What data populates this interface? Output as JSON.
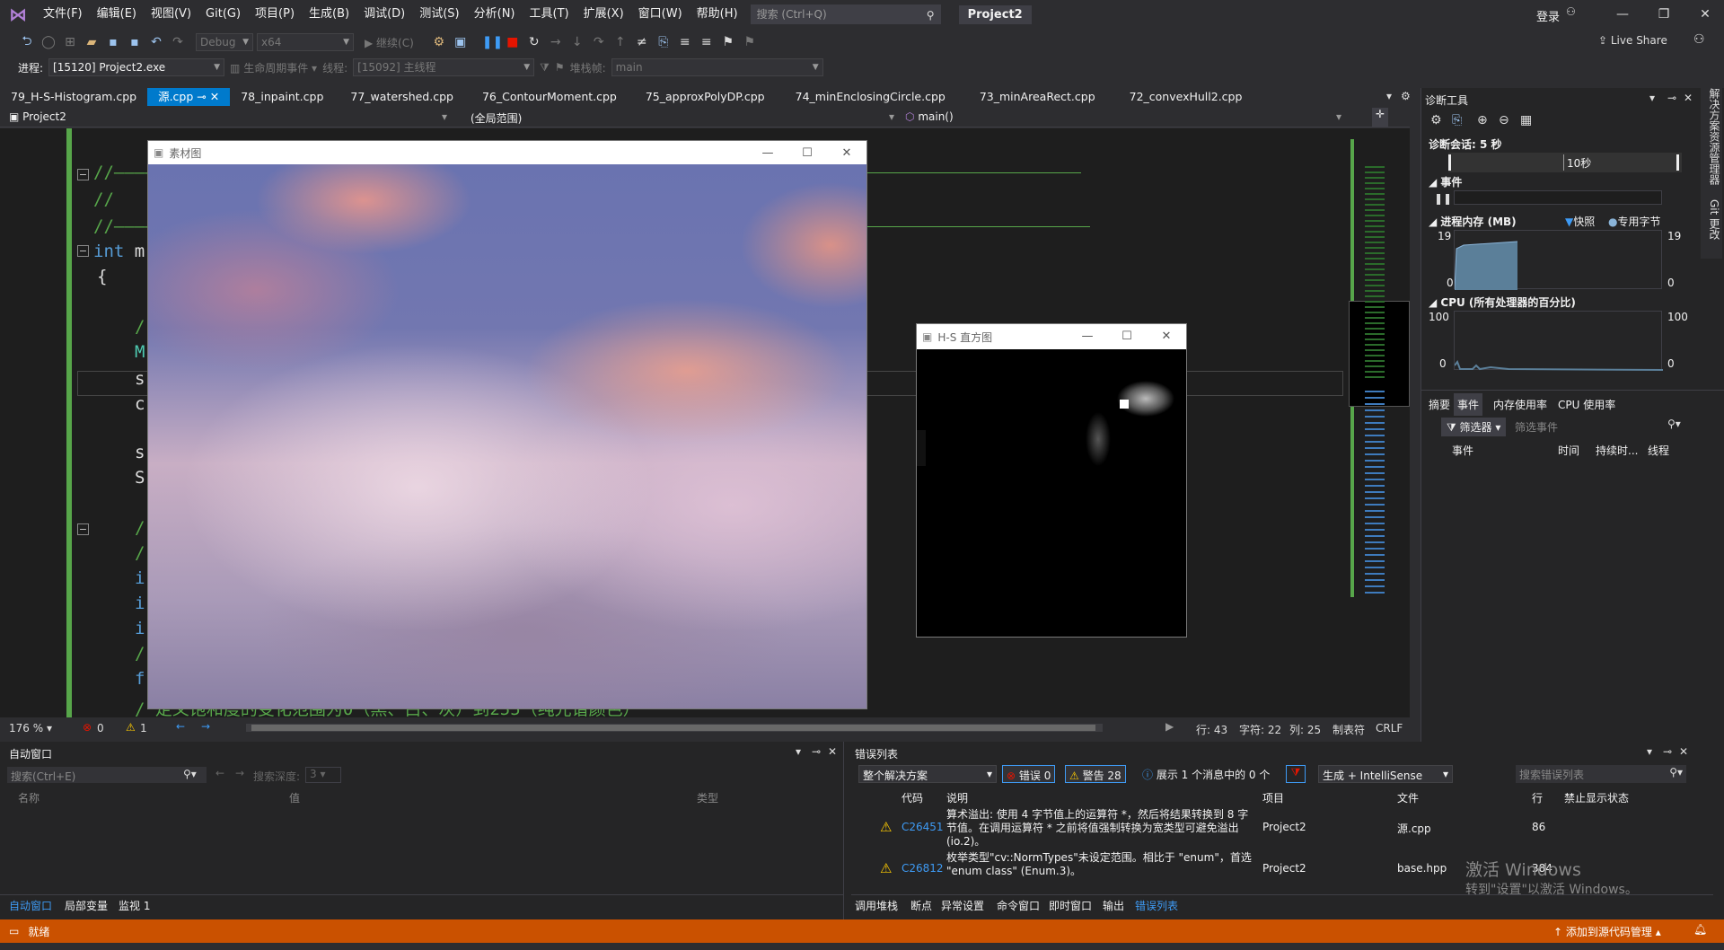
{
  "menubar": {
    "items": [
      "文件(F)",
      "编辑(E)",
      "视图(V)",
      "Git(G)",
      "项目(P)",
      "生成(B)",
      "调试(D)",
      "测试(S)",
      "分析(N)",
      "工具(T)",
      "扩展(X)",
      "窗口(W)",
      "帮助(H)"
    ],
    "search_placeholder": "搜索 (Ctrl+Q)",
    "project_title": "Project2",
    "login": "登录",
    "live_share": "Live Share"
  },
  "toolbar": {
    "config": "Debug",
    "platform": "x64",
    "continue": "继续(C)",
    "process_label": "进程:",
    "process_value": "[15120] Project2.exe",
    "lifecycle": "生命周期事件",
    "thread_label": "线程:",
    "thread_value": "[15092] 主线程",
    "stack_label": "堆栈帧:",
    "stack_value": "main"
  },
  "tabs": [
    "79_H-S-Histogram.cpp",
    "源.cpp",
    "78_inpaint.cpp",
    "77_watershed.cpp",
    "76_ContourMoment.cpp",
    "75_approxPolyDP.cpp",
    "74_minEnclosingCircle.cpp",
    "73_minAreaRect.cpp",
    "72_convexHull2.cpp"
  ],
  "navbar": {
    "project": "Project2",
    "scope": "(全局范围)",
    "func": "main()"
  },
  "code": {
    "l1": "//—————————",
    "l2": "//",
    "l3": "//—————————",
    "l4a": "int",
    "l4b": " m",
    "l5": "{",
    "l6": "/",
    "l7": "M",
    "l8": "s",
    "l9": "c",
    "l10": "s",
    "l11": "S",
    "l12": "/",
    "l13": "/",
    "l14": "i",
    "l15": "i",
    "l16": "i",
    "l17": "/",
    "l18": "f",
    "l19": "/ 定义饱和度的变化范围为0（黑、白、灰）到255（纯光谱颜色）"
  },
  "window_src": {
    "title": "素材图"
  },
  "window_hs": {
    "title": "H-S 直方图"
  },
  "editor_status": {
    "zoom": "176 %",
    "errors": "0",
    "warnings": "1",
    "line": "行: 43",
    "char": "字符: 22",
    "col": "列: 25",
    "tab": "制表符",
    "eol": "CRLF"
  },
  "diag": {
    "title": "诊断工具",
    "session": "诊断会话: 5 秒",
    "time": "10秒",
    "events": "事件",
    "memory": "进程内存 (MB)",
    "snapshot": "快照",
    "private": "专用字节",
    "mem_max": "19",
    "mem_min": "0",
    "cpu": "CPU (所有处理器的百分比)",
    "cpu_max": "100",
    "cpu_min": "0",
    "tabs": [
      "摘要",
      "事件",
      "内存使用率",
      "CPU 使用率"
    ],
    "filter": "筛选器",
    "filter_placeholder": "筛选事件",
    "cols": [
      "事件",
      "时间",
      "持续时...",
      "线程"
    ]
  },
  "side_tabs": [
    "解决方案资源管理器",
    "Git 更改"
  ],
  "autos": {
    "title": "自动窗口",
    "search": "搜索(Ctrl+E)",
    "depth_label": "搜索深度:",
    "depth": "3",
    "cols": [
      "名称",
      "值",
      "类型"
    ],
    "tabs": [
      "自动窗口",
      "局部变量",
      "监视 1"
    ]
  },
  "errors": {
    "title": "错误列表",
    "scope": "整个解决方案",
    "err": "错误 0",
    "warn": "警告 28",
    "info": "展示 1 个消息中的 0 个",
    "build": "生成 + IntelliSense",
    "search": "搜索错误列表",
    "cols": [
      "代码",
      "说明",
      "项目",
      "文件",
      "行",
      "禁止显示状态"
    ],
    "rows": [
      {
        "code": "C26451",
        "desc": "算术溢出: 使用 4 字节值上的运算符 *，然后将结果转换到 8 字节值。在调用运算符 * 之前将值强制转换为宽类型可避免溢出 (io.2)。",
        "project": "Project2",
        "file": "源.cpp",
        "line": "86"
      },
      {
        "code": "C26812",
        "desc": "枚举类型\"cv::NormTypes\"未设定范围。相比于 \"enum\"，首选 \"enum class\" (Enum.3)。",
        "project": "Project2",
        "file": "base.hpp",
        "line": "384"
      }
    ],
    "tabs": [
      "调用堆栈",
      "断点",
      "异常设置",
      "命令窗口",
      "即时窗口",
      "输出",
      "错误列表"
    ]
  },
  "watermark": {
    "l1": "激活 Windows",
    "l2": "转到\"设置\"以激活 Windows。"
  },
  "statusbar": {
    "ready": "就绪",
    "source_control": "添加到源代码管理"
  }
}
